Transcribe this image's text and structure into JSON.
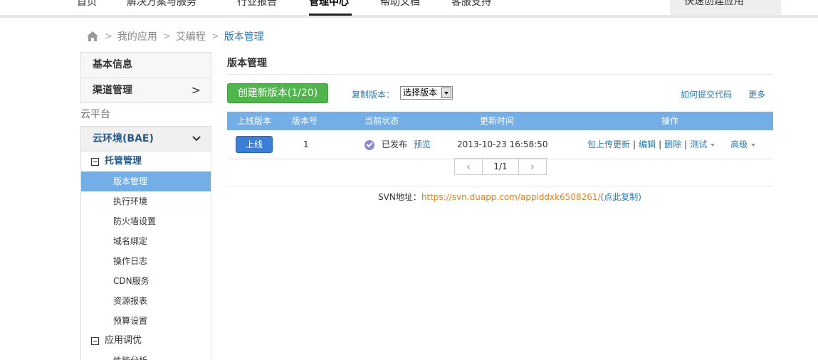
{
  "nav": {
    "items": [
      "首页",
      "解决方案与服务",
      "行业报告",
      "管理中心",
      "帮助文档",
      "客服支持"
    ],
    "quick_create": "快速创建应用"
  },
  "breadcrumb": {
    "items": [
      "我的应用",
      "艾编程"
    ],
    "current": "版本管理"
  },
  "sidebar": {
    "basic_info": "基本信息",
    "channel": "渠道管理",
    "section_cloud": "云平台",
    "env": "云环境(BAE)",
    "group_hosting": "托管管理",
    "items": [
      "版本管理",
      "执行环境",
      "防火墙设置",
      "域名绑定",
      "操作日志",
      "CDN服务",
      "资源报表",
      "预算设置"
    ],
    "group_tuning": "应用调优",
    "next_item": "性能分析"
  },
  "main": {
    "title": "版本管理",
    "create_button": "创建新版本(1/20)",
    "copy_label": "复制版本：",
    "copy_select": "选择版本",
    "how_submit": "如何提交代码",
    "more": "更多"
  },
  "table": {
    "headers": [
      "上线版本",
      "版本号",
      "当前状态",
      "更新时间",
      "操作"
    ],
    "row": {
      "online_button": "上线",
      "version": "1",
      "status": "已发布",
      "preview": "预览",
      "time": "2013-10-23 16:58:50",
      "ops": [
        "包上传更新",
        "编辑",
        "删除",
        "测试"
      ],
      "advanced": "高级"
    }
  },
  "pager": {
    "prev": "<",
    "page": "1/1",
    "next": ">"
  },
  "svn": {
    "label": "SVN地址：",
    "url": "https://svn.duapp.com/appiddxk6508261/",
    "copy": "(点此复制)"
  }
}
